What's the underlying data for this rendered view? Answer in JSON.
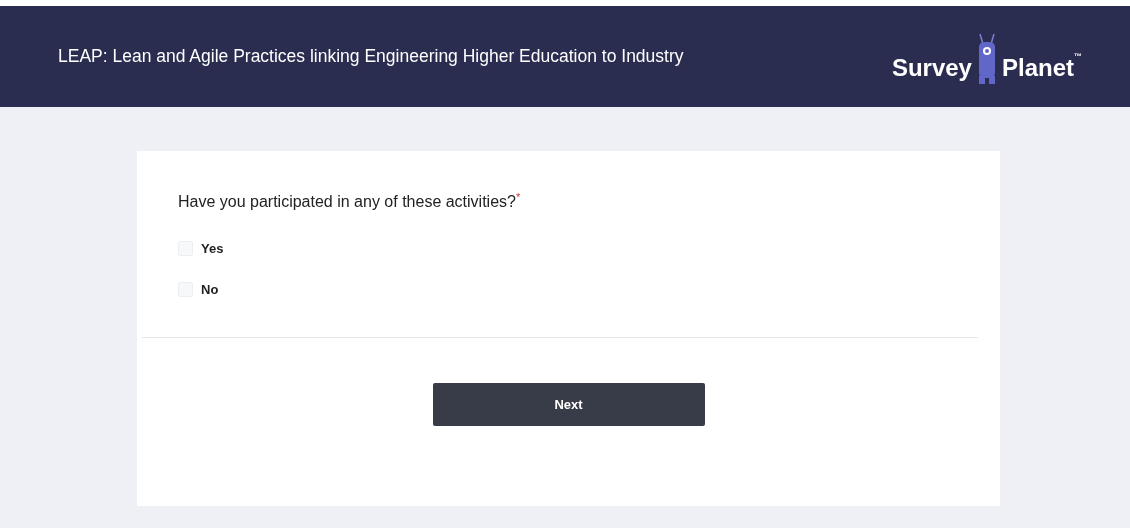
{
  "header": {
    "title": "LEAP: Lean and Agile Practices linking Engineering Higher Education to Industry",
    "logo": {
      "word_1": "Survey",
      "word_2": "Planet",
      "mark": "™"
    }
  },
  "question": {
    "text": "Have you participated in any of these activities?",
    "required_mark": "*",
    "options": [
      {
        "label": "Yes",
        "checked": false
      },
      {
        "label": "No",
        "checked": false
      }
    ]
  },
  "button": {
    "label": "Next"
  }
}
